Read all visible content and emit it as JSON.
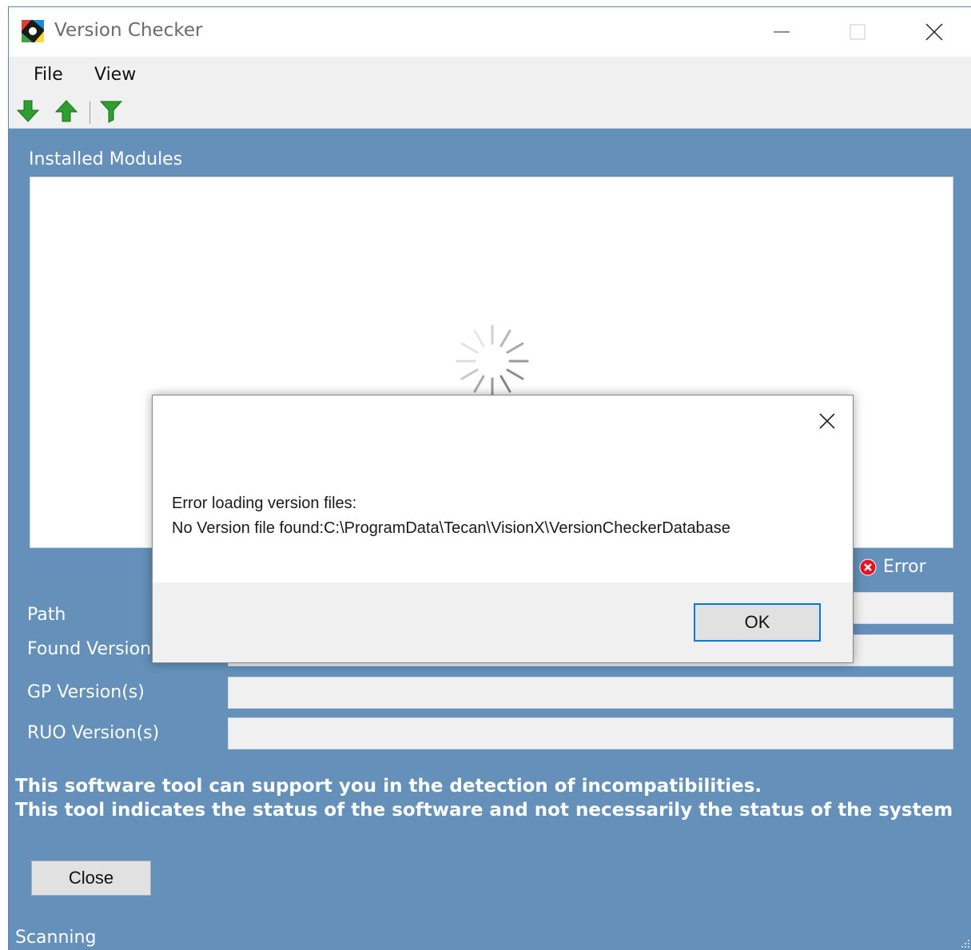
{
  "window": {
    "title": "Version Checker"
  },
  "menu": {
    "items": [
      "File",
      "View"
    ]
  },
  "toolbar": {
    "icons": [
      "arrow-down-icon",
      "arrow-up-icon",
      "filter-icon"
    ]
  },
  "modules": {
    "label": "Installed Modules"
  },
  "status_indicator": {
    "label": "Error",
    "color": "#e81123"
  },
  "fields": {
    "path_label": "Path",
    "found_version_label": "Found Version",
    "gp_versions_label": "GP Version(s)",
    "ruo_versions_label": "RUO Version(s)",
    "path_value": "",
    "found_version_value": "",
    "gp_versions_value": "",
    "ruo_versions_value": ""
  },
  "info": {
    "line1": "This software tool can support you in the detection of incompatibilities.",
    "line2": "This tool indicates the status of the software and not necessarily the status of the system"
  },
  "buttons": {
    "close": "Close"
  },
  "status": {
    "text": "Scanning"
  },
  "dialog": {
    "line1": "Error loading version files:",
    "line2": "No Version file found:C:\\ProgramData\\Tecan\\VisionX\\VersionCheckerDatabase",
    "ok": "OK"
  },
  "colors": {
    "background": "#6490b9",
    "accent": "#0078d7",
    "icon_green": "#2e9e2e"
  }
}
